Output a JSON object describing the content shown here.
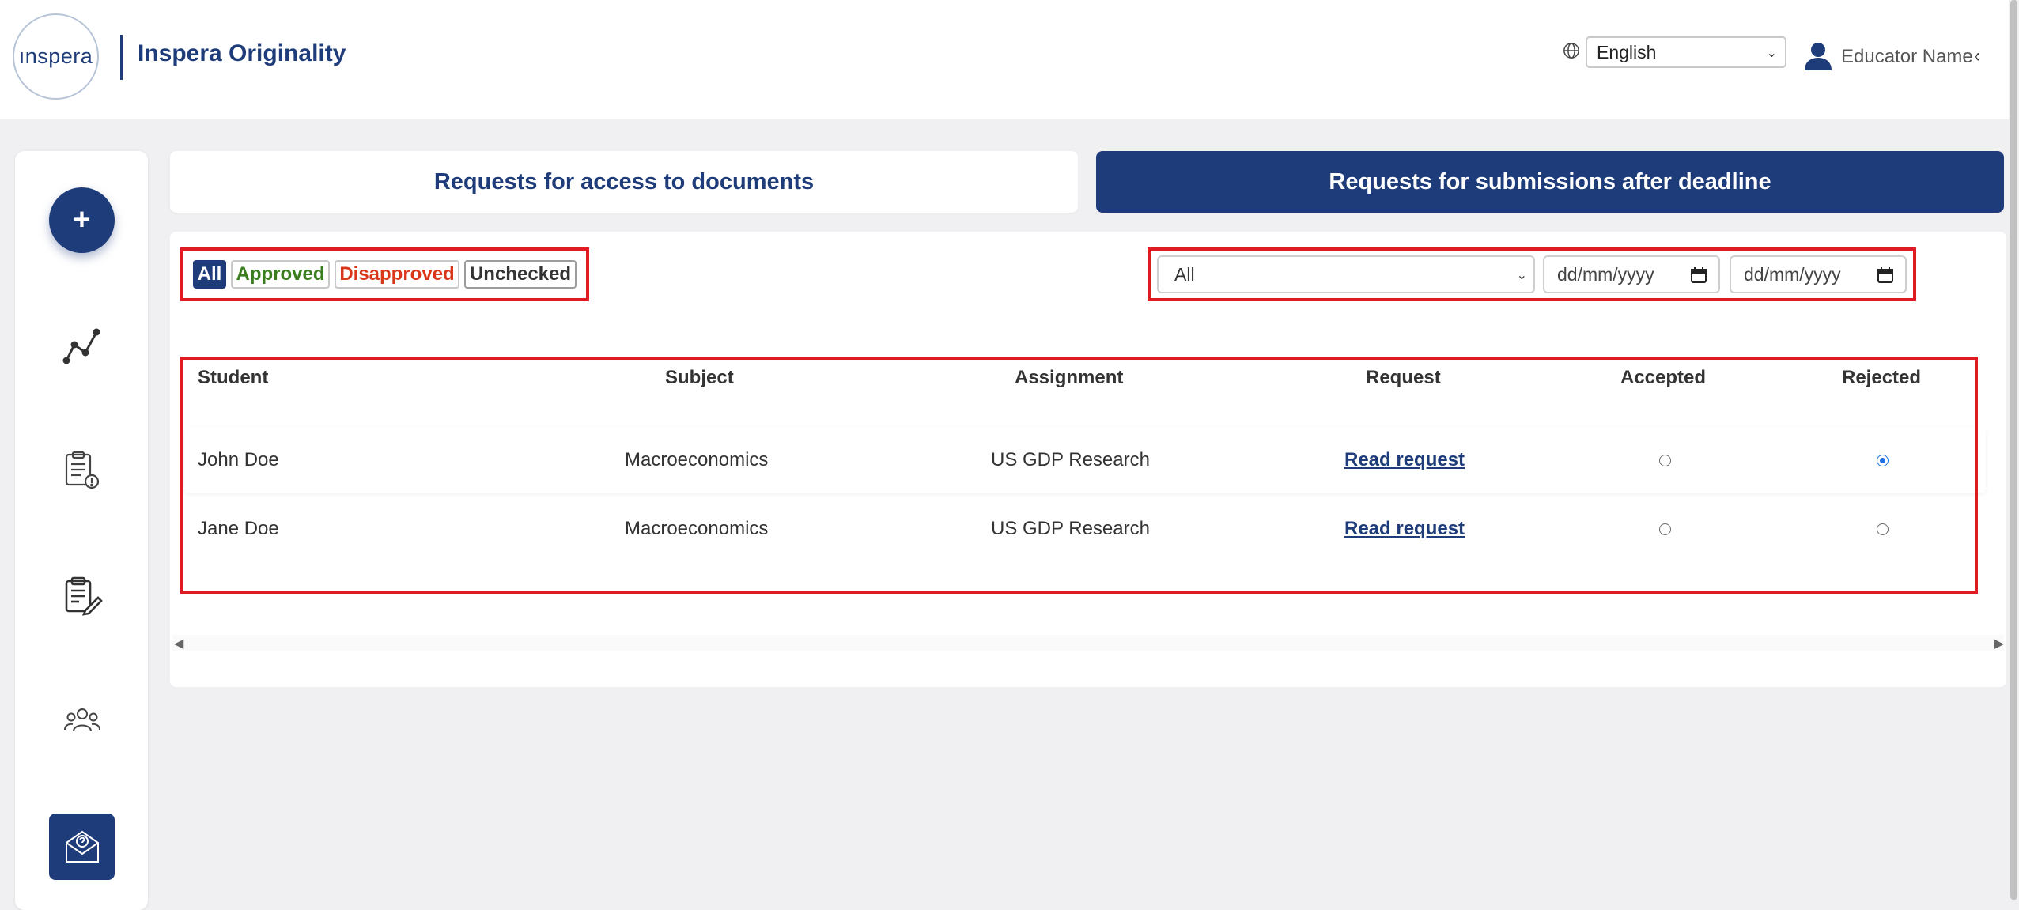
{
  "header": {
    "logo_text": "ınspera",
    "brand": "Inspera Originality",
    "language": "English",
    "user_name": "Educator Name"
  },
  "sidebar": {
    "add_label": "+",
    "items": [
      "analytics-icon",
      "documents-icon",
      "assignments-icon",
      "groups-icon"
    ],
    "mail_icon": "mail-question-icon"
  },
  "tabs": [
    {
      "label": "Requests for access to documents",
      "active": false
    },
    {
      "label": "Requests for submissions after deadline",
      "active": true
    }
  ],
  "filters": {
    "chips": [
      {
        "label": "All",
        "color": "#1f3c7a"
      },
      {
        "label": "Approved",
        "color": "#3a7d1e"
      },
      {
        "label": "Disapproved",
        "color": "#d9361a"
      },
      {
        "label": "Unchecked",
        "color": "#333333"
      }
    ],
    "select_value": "All",
    "date_from_placeholder": "dd/mm/yyyy",
    "date_to_placeholder": "dd/mm/yyyy"
  },
  "table": {
    "columns": [
      "Student",
      "Subject",
      "Assignment",
      "Request",
      "Accepted",
      "Rejected"
    ],
    "rows": [
      {
        "student": "John Doe",
        "subject": "Macroeconomics",
        "assignment": "US GDP Research",
        "request": "Read request",
        "accepted": false,
        "rejected": true
      },
      {
        "student": "Jane Doe",
        "subject": "Macroeconomics",
        "assignment": "US GDP Research",
        "request": "Read request",
        "accepted": false,
        "rejected": false
      }
    ]
  },
  "colors": {
    "brand": "#1f3c7a",
    "highlight": "#e01b24",
    "radio_checked": "#1a73e8"
  }
}
